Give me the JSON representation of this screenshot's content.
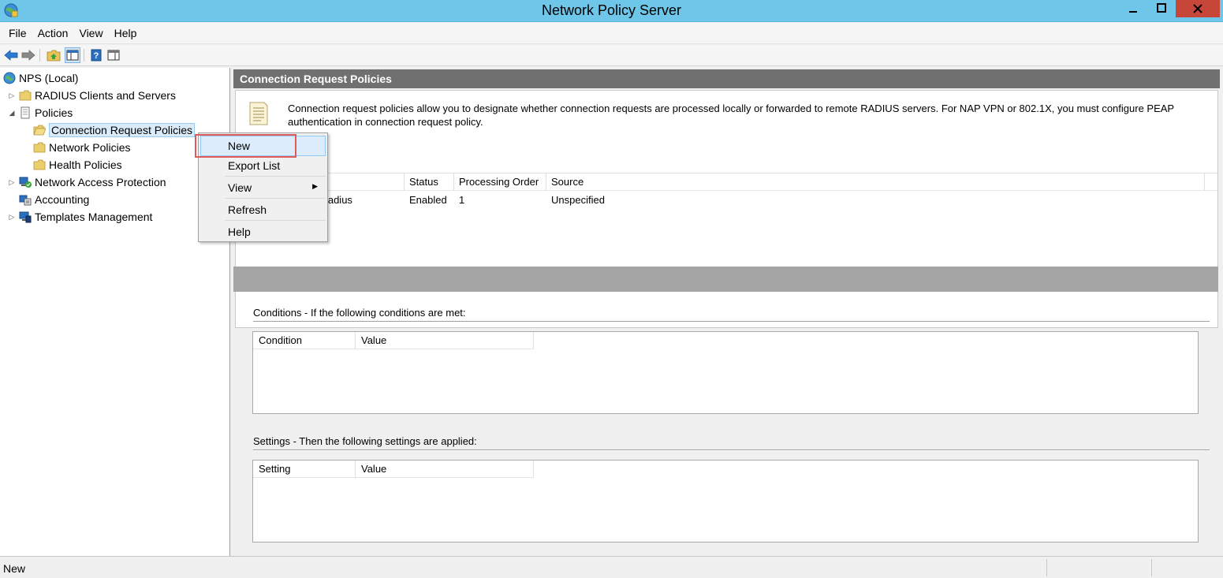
{
  "window": {
    "title": "Network Policy Server"
  },
  "menubar": [
    "File",
    "Action",
    "View",
    "Help"
  ],
  "tree": {
    "root": "NPS (Local)",
    "radius_clients": "RADIUS Clients and Servers",
    "policies": "Policies",
    "connection_request_policies": "Connection Request Policies",
    "network_policies": "Network Policies",
    "health_policies": "Health Policies",
    "network_access_protection": "Network Access Protection",
    "accounting": "Accounting",
    "templates_management": "Templates Management"
  },
  "content": {
    "header": "Connection Request Policies",
    "description": "Connection request policies allow you to designate whether connection requests are processed locally or forwarded to remote RADIUS servers. For NAP VPN or 802.1X, you must configure PEAP authentication in connection request policy.",
    "columns": [
      "Status",
      "Processing Order",
      "Source"
    ],
    "row": {
      "name": "ivity to Radius",
      "status": "Enabled",
      "order": "1",
      "source": "Unspecified"
    },
    "conditions_label": "Conditions - If the following conditions are met:",
    "conditions_columns": [
      "Condition",
      "Value"
    ],
    "settings_label": "Settings - Then the following settings are applied:",
    "settings_columns": [
      "Setting",
      "Value"
    ]
  },
  "context_menu": {
    "new": "New",
    "export_list": "Export List",
    "view": "View",
    "refresh": "Refresh",
    "help": "Help"
  },
  "status": {
    "text": "New"
  },
  "colors": {
    "titlebar": "#6ec6e8",
    "close": "#c7463a",
    "highlight": "#e05a5a",
    "header_band": "#707070"
  }
}
